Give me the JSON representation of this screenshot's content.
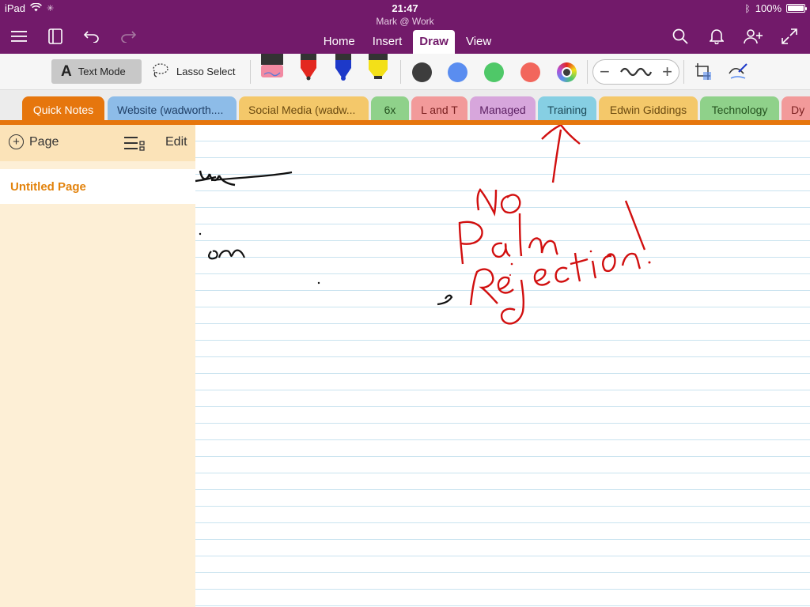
{
  "status": {
    "device": "iPad",
    "time": "21:47",
    "battery": "100%",
    "battery_level": 1.0
  },
  "notebook": {
    "name": "Mark @ Work"
  },
  "ribbon": {
    "tabs": [
      {
        "label": "Home",
        "active": false
      },
      {
        "label": "Insert",
        "active": false
      },
      {
        "label": "Draw",
        "active": true
      },
      {
        "label": "View",
        "active": false
      }
    ]
  },
  "toolbar": {
    "text_mode_icon": "A",
    "text_mode": "Text Mode",
    "lasso": "Lasso Select",
    "pens": [
      {
        "name": "eraser-pen",
        "color": "#f28aa2"
      },
      {
        "name": "red-pen",
        "color": "#e3271f"
      },
      {
        "name": "blue-pen",
        "color": "#1d39c9"
      },
      {
        "name": "highlighter",
        "color": "#f3e018"
      }
    ],
    "colors": [
      "#3d3d3d",
      "#5a8df0",
      "#4fc868",
      "#f2665c"
    ],
    "thickness_minus": "−",
    "thickness_plus": "+"
  },
  "sections": [
    {
      "label": "Quick Notes",
      "color": "#e6760d",
      "text_color": "#ffffff"
    },
    {
      "label": "Website (wadworth....",
      "color": "#8dbce8",
      "text_color": "#1f3f66"
    },
    {
      "label": "Social Media (wadw...",
      "color": "#f4c86a",
      "text_color": "#6b4a10"
    },
    {
      "label": "6x",
      "color": "#8fd18a",
      "text_color": "#24521f"
    },
    {
      "label": "L and T",
      "color": "#f29a9a",
      "text_color": "#7a1f1f"
    },
    {
      "label": "Managed",
      "color": "#d7a6dc",
      "text_color": "#5b1f62"
    },
    {
      "label": "Training",
      "color": "#86cfe3",
      "text_color": "#1c4a59"
    },
    {
      "label": "Edwin Giddings",
      "color": "#f4c86a",
      "text_color": "#6b4a10"
    },
    {
      "label": "Technology",
      "color": "#8fd18a",
      "text_color": "#24521f"
    },
    {
      "label": "Dy",
      "color": "#f29a9a",
      "text_color": "#7a1f1f"
    }
  ],
  "sidebar": {
    "add_page": "Page",
    "edit": "Edit",
    "pages": [
      {
        "title": "Untitled Page",
        "selected": true
      }
    ]
  },
  "ink_note": "No Palm Rejection!"
}
